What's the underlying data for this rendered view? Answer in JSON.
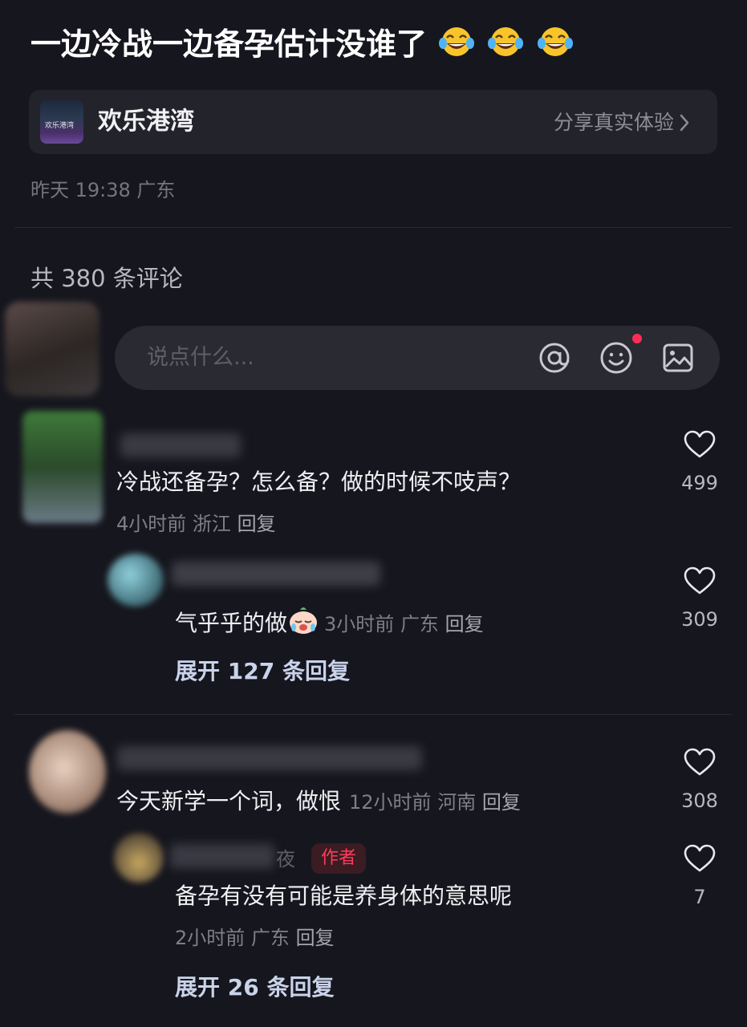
{
  "post": {
    "title": "一边冷战一边备孕估计没谁了",
    "title_emoji_count": 3,
    "topic_name": "欢乐港湾",
    "topic_thumb_text": "欢乐港湾",
    "topic_action": "分享真实体验",
    "meta": "昨天 19:38 广东"
  },
  "comments_header": {
    "count_text": "共 380 条评论"
  },
  "input": {
    "placeholder": "说点什么..."
  },
  "comments": [
    {
      "name_partial": "长胎不长肉",
      "text": "冷战还备孕？怎么备？做的时候不吱声？",
      "meta_time": "4小时前",
      "meta_region": "浙江",
      "reply_label": "回复",
      "likes": "499",
      "replies": [
        {
          "text": "气乎乎的做",
          "meta_time": "3小时前",
          "meta_region": "广东",
          "reply_label": "回复",
          "likes": "309"
        }
      ],
      "expand_label": "展开 127 条回复"
    },
    {
      "text": "今天新学一个词，做恨",
      "meta_time": "12小时前",
      "meta_region": "河南",
      "reply_label": "回复",
      "likes": "308",
      "replies": [
        {
          "name_partial": "夜",
          "badge": "作者",
          "text": "备孕有没有可能是养身体的意思呢",
          "meta_time": "2小时前",
          "meta_region": "广东",
          "reply_label": "回复",
          "likes": "7"
        }
      ],
      "expand_label": "展开 26 条回复"
    }
  ],
  "colors": {
    "background": "#16161e",
    "card": "#23232c",
    "accent_red": "#ff2d55",
    "author_badge": "#ff3b5c",
    "expand_text": "#c9d3ea"
  }
}
